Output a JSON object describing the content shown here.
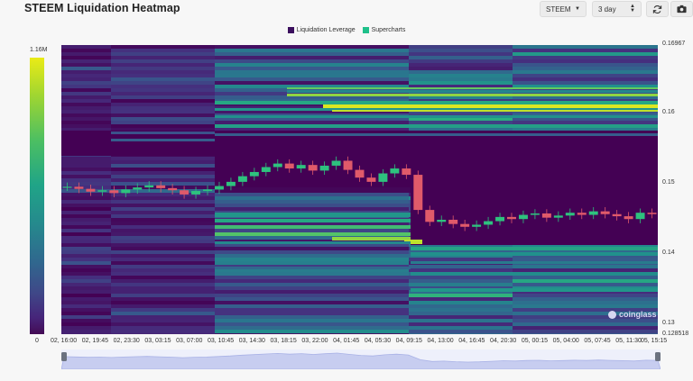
{
  "header": {
    "title": "STEEM Liquidation Heatmap",
    "symbol_select": "STEEM",
    "range_select": "3 day",
    "refresh_icon": "refresh-icon",
    "camera_icon": "camera-icon"
  },
  "legend": {
    "items": [
      {
        "label": "Liquidation Leverage",
        "color": "#3b0f5e"
      },
      {
        "label": "Supercharts",
        "color": "#1fc08a"
      }
    ]
  },
  "colorbar": {
    "max_label": "1.16M",
    "min_label": "0"
  },
  "watermark": "coinglass",
  "chart_data": {
    "type": "heatmap",
    "title": "STEEM Liquidation Heatmap",
    "ylim": [
      0.128518,
      0.16967
    ],
    "y_ticks": [
      "0.16967",
      "0.16",
      "0.15",
      "0.14",
      "0.13",
      "0.128518"
    ],
    "x_ticks": [
      "02, 16:00",
      "02, 19:45",
      "02, 23:30",
      "03, 03:15",
      "03, 07:00",
      "03, 10:45",
      "03, 14:30",
      "03, 18:15",
      "03, 22:00",
      "04, 01:45",
      "04, 05:30",
      "04, 09:15",
      "04, 13:00",
      "04, 16:45",
      "04, 20:30",
      "05, 00:15",
      "05, 04:00",
      "05, 07:45",
      "05, 11:30",
      "05, 15:15"
    ],
    "colorbar_range": [
      0,
      1160000
    ],
    "price_series": [
      0.1495,
      0.1492,
      0.1488,
      0.149,
      0.1486,
      0.1491,
      0.1494,
      0.1497,
      0.1493,
      0.149,
      0.1484,
      0.1489,
      0.1491,
      0.1496,
      0.1502,
      0.151,
      0.1516,
      0.1523,
      0.1528,
      0.1521,
      0.1526,
      0.1518,
      0.1525,
      0.1532,
      0.1519,
      0.1508,
      0.1502,
      0.1514,
      0.1521,
      0.1512,
      0.1462,
      0.1445,
      0.1448,
      0.1442,
      0.1438,
      0.1441,
      0.1446,
      0.1452,
      0.1449,
      0.1455,
      0.1457,
      0.1451,
      0.1454,
      0.1458,
      0.1455,
      0.146,
      0.1456,
      0.1453,
      0.1449,
      0.1458,
      0.1456
    ]
  }
}
